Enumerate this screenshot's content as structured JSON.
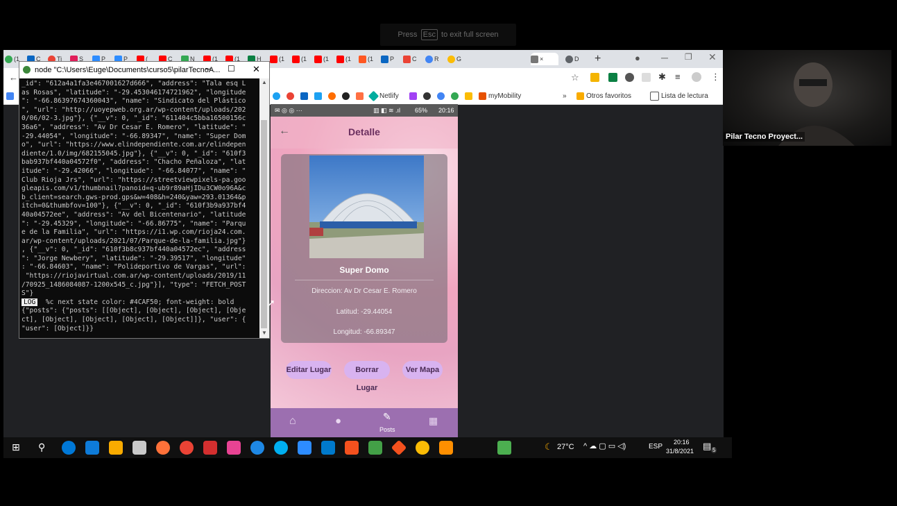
{
  "fullscreen_hint": {
    "pre": "Press",
    "key": "Esc",
    "post": "to exit full screen"
  },
  "browser": {
    "tabs": [
      "(1",
      "C",
      "Ti",
      "S",
      "P",
      "P",
      "(",
      "C",
      "N",
      "(1",
      "(1",
      "H",
      "(1",
      "(1",
      "(1",
      "(1",
      "(1",
      "P",
      "C",
      "R",
      "G",
      "×",
      "D"
    ],
    "new_tab": "+",
    "bookmarks": [
      "Netlify",
      "myMobility",
      "»",
      "Otros favoritos",
      "Lista de lectura"
    ]
  },
  "console": {
    "title": "node  \"C:\\Users\\Euge\\Documents\\curso5\\pilarTecnoA...",
    "lines": [
      "_id\": \"612a4a1fa3e467001627d666\", \"address\": \"Tala esq L",
      "as Rosas\", \"latitude\": \"-29.453046174721962\", \"longitude",
      "\": \"-66.86397674360043\", \"name\": \"Sindicato del Plástico",
      "\", \"url\": \"http://uoyepweb.org.ar/wp-content/uploads/202",
      "0/06/02-3.jpg\"}, {\"__v\": 0, \"_id\": \"611404c5bba16500156c",
      "36a6\", \"address\": \"Av Dr Cesar E. Romero\", \"latitude\": \"",
      "-29.44054\", \"longitude\": \"-66.89347\", \"name\": \"Super Dom",
      "o\", \"url\": \"https://www.elindependiente.com.ar/elindepen",
      "diente/1.0/img/682155045.jpg\"}, {\"__v\": 0, \"_id\": \"610f3",
      "bab937bf440a04572f0\", \"address\": \"Chacho Peñaloza\", \"lat",
      "itude\": \"-29.42066\", \"longitude\": \"-66.84077\", \"name\": \"",
      "Club Rioja Jrs\", \"url\": \"https://streetviewpixels-pa.goo",
      "gleapis.com/v1/thumbnail?panoid=q-ub9r89aHjIDu3CW0o96A&c",
      "b_client=search.gws-prod.gps&w=408&h=240&yaw=293.01364&p",
      "itch=0&thumbfov=100\"}, {\"__v\": 0, \"_id\": \"610f3b9a937bf4",
      "40a04572ee\", \"address\": \"Av del Bicentenario\", \"latitude",
      "\": \"-29.45329\", \"longitude\": \"-66.86775\", \"name\": \"Parqu",
      "e de la Familia\", \"url\": \"https://i1.wp.com/rioja24.com.",
      "ar/wp-content/uploads/2021/07/Parque-de-la-familia.jpg\"}",
      ", {\"__v\": 0, \"_id\": \"610f3b8c937bf440a04572ec\", \"address",
      "\": \"Jorge Newbery\", \"latitude\": \"-29.39517\", \"longitude\"",
      ": \"-66.84603\", \"name\": \"Polideportivo de Vargas\", \"url\":",
      " \"https://riojavirtual.com.ar/wp-content/uploads/2019/11",
      "/70925_1486084087-1200x545_c.jpg\"}], \"type\": \"FETCH_POST",
      "S\"}"
    ],
    "log_label": "LOG",
    "log_text": "  %c next state color: #4CAF50; font-weight: bold",
    "tail_lines": [
      "{\"posts\": {\"posts\": [[Object], [Object], [Object], [Obje",
      "ct], [Object], [Object], [Object], [Object]]}, \"user\": {",
      "\"user\": [Object]}}"
    ]
  },
  "phone": {
    "status_time": "20:16",
    "status_battery": "65%",
    "title": "Detalle",
    "place_name": "Super Domo",
    "address": "Direccion: Av Dr Cesar E. Romero",
    "latitude": "Latitud: -29.44054",
    "longitude": "Longitud: -66.89347",
    "buttons": {
      "edit": "Editar Lugar",
      "delete": "Borrar Lugar",
      "map": "Ver Mapa"
    },
    "nav_active_label": "Posts"
  },
  "taskbar": {
    "weather": "27°C",
    "lang": "ESP",
    "time": "20:16",
    "date": "31/8/2021",
    "notif_count": "5"
  },
  "webcam": {
    "name": "Pilar Tecno Proyect..."
  }
}
